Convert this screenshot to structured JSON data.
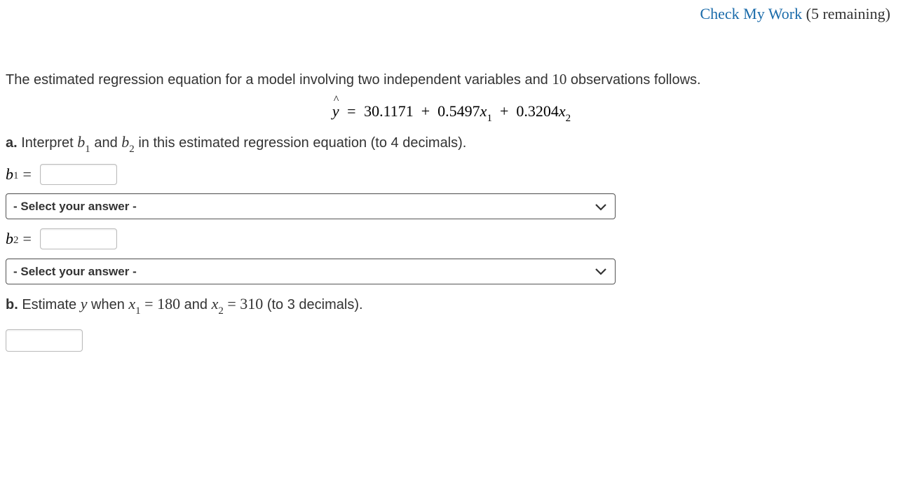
{
  "header": {
    "link_text": "Check My Work",
    "remaining_text": "(5 remaining)"
  },
  "intro_prefix": "The estimated regression equation for a model involving two independent variables and ",
  "intro_n": "10",
  "intro_suffix": " observations follows.",
  "equation": {
    "lhs_var": "ŷ",
    "intercept": "30.1171",
    "b1": "0.5497",
    "x1": "x",
    "x1_sub": "1",
    "b2": "0.3204",
    "x2": "x",
    "x2_sub": "2"
  },
  "part_a": {
    "label": "a.",
    "text_before": " Interpret ",
    "b1_var": "b",
    "b1_sub": "1",
    "mid": " and ",
    "b2_var": "b",
    "b2_sub": "2",
    "text_after": " in this estimated regression equation (to 4 decimals)."
  },
  "row_b1": {
    "var": "b",
    "sub": "1",
    "eq": "="
  },
  "row_b2": {
    "var": "b",
    "sub": "2",
    "eq": "="
  },
  "select_placeholder": "- Select your answer -",
  "part_b": {
    "label": "b.",
    "t1": " Estimate ",
    "yvar": "y",
    "t2": " when ",
    "x1": "x",
    "x1_sub": "1",
    "eq1": " = ",
    "v1": "180",
    "t3": " and ",
    "x2": "x",
    "x2_sub": "2",
    "eq2": " = ",
    "v2": "310",
    "t4": " (to 3 decimals)."
  }
}
